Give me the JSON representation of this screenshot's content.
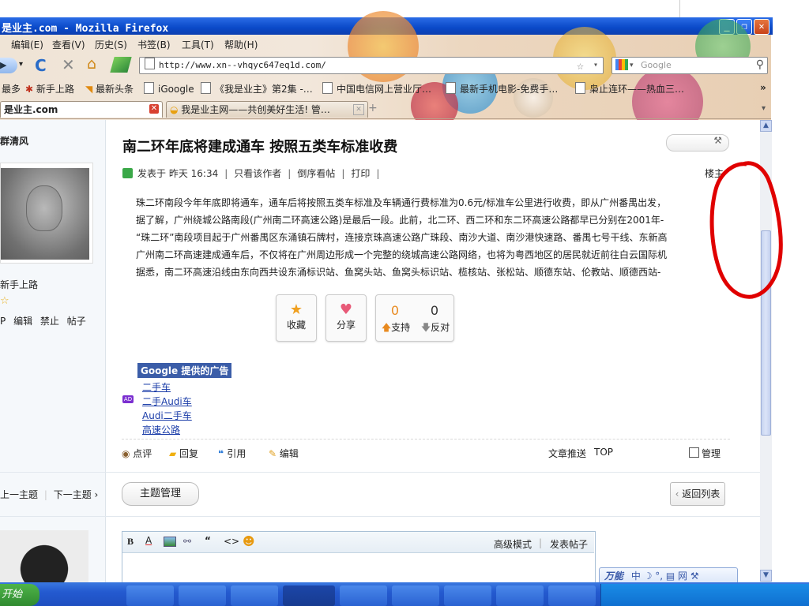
{
  "window": {
    "title": "是业主.com - Mozilla Firefox",
    "controls": {
      "minimize": "_",
      "restore": "❐",
      "close": "✕"
    }
  },
  "menubar": [
    "编辑(E)",
    "查看(V)",
    "历史(S)",
    "书签(B)",
    "工具(T)",
    "帮助(H)"
  ],
  "navbar": {
    "url": "http://www.xn--vhqyc647eq1d.com/",
    "search_placeholder": "Google"
  },
  "bookmarks": [
    "最多",
    "新手上路",
    "最新头条",
    "iGoogle",
    "《我是业主》第2集 -…",
    "中国电信网上营业厅…",
    "最新手机电影-免费手…",
    "枭止连环——热血三…"
  ],
  "tabs": [
    {
      "label": "是业主.com",
      "active": true
    },
    {
      "label": "我是业主网——共创美好生活! 管…",
      "active": false
    }
  ],
  "sidebar": {
    "username": "群清风",
    "group": "新手上路",
    "actions": [
      "P",
      "编辑",
      "禁止",
      "帖子"
    ],
    "prev_thread": "上一主题",
    "next_thread": "下一主题 ›"
  },
  "post": {
    "title": "南二环年底将建成通车  按照五类车标准收费",
    "meta": {
      "posted": "发表于 昨天 16:34",
      "author_only": "只看该作者",
      "reverse": "倒序看帖",
      "print": "打印",
      "floor": "楼主"
    },
    "body_lines": [
      "珠二环南段今年年底即将通车，通车后将按照五类车标准及车辆通行费标准为0.6元/标准车公里进行收费，即从广州番禺出发，",
      "据了解，广州绕城公路南段(广州南二环高速公路)是最后一段。此前，北二环、西二环和东二环高速公路都早已分别在2001年-",
      "“珠二环”南段项目起于广州番禺区东涌镇石牌村，连接京珠高速公路广珠段、南沙大道、南沙港快速路、番禺七号干线、东新高",
      "广州南二环高速建成通车后，不仅将在广州周边形成一个完整的绕城高速公路网络，也将为粤西地区的居民就近前往白云国际机",
      "据悉，南二环高速沿线由东向西共设东涌标识站、鱼窝头站、鱼窝头标识站、榄核站、张松站、顺德东站、伦教站、顺德西站-"
    ],
    "actions": {
      "collect": "收藏",
      "share": "分享",
      "support_count": "0",
      "oppose_count": "0",
      "support": "支持",
      "oppose": "反对"
    },
    "ads": {
      "heading": "Google 提供的广告",
      "badge": "AD",
      "links": [
        "二手车",
        "二手Audi车",
        "Audi二手车",
        "高速公路"
      ]
    },
    "footer": {
      "comment": "点评",
      "reply": "回复",
      "quote": "引用",
      "edit": "编辑",
      "recommend": "文章推送",
      "top": "TOP",
      "manage": "管理"
    }
  },
  "thread_manage": "主题管理",
  "back_to_list": "返回列表",
  "editor": {
    "tools": [
      "B",
      "A",
      "image",
      "attachment",
      "quote",
      "code",
      "smiley"
    ],
    "advanced": "高级模式",
    "post": "发表帖子"
  },
  "ime": {
    "name": "万能",
    "mode": "中 ☽ °, ▤ 网 ⚒"
  },
  "taskbar": {
    "start": "开始"
  },
  "colors": {
    "link": "#1a3ca8",
    "ad_heading_bg": "#3b5da8",
    "title_bar": "#0a49c8",
    "annotation": "#e00000"
  }
}
